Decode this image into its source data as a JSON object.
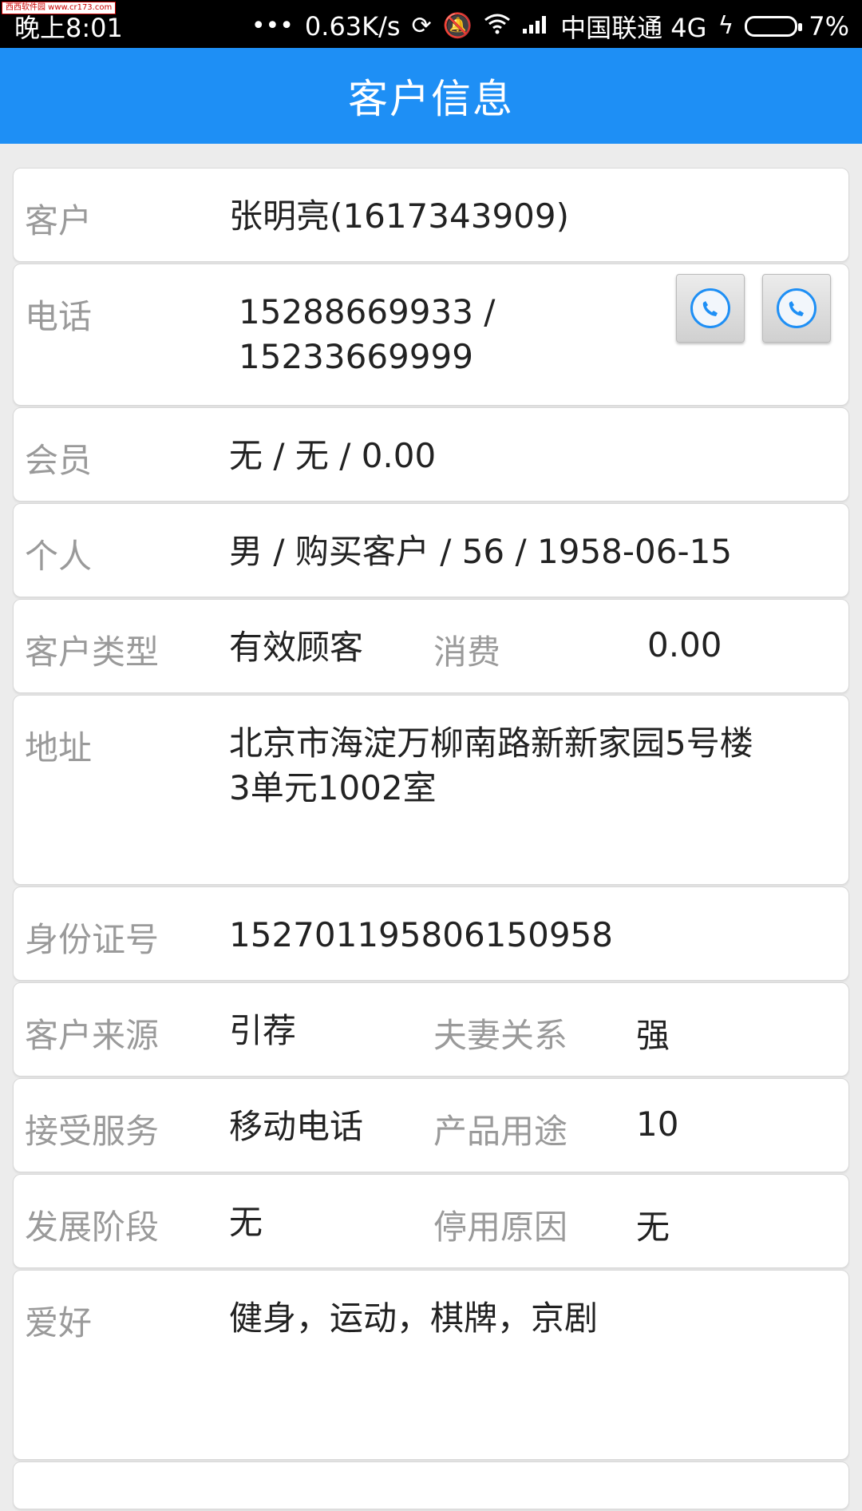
{
  "status_bar": {
    "time": "晚上8:01",
    "speed": "0.63K/s",
    "carrier": "中国联通 4G",
    "battery": "7%",
    "watermark": "西西软件园 www.cr173.com"
  },
  "header": {
    "title": "客户信息"
  },
  "rows": [
    {
      "label": "客户",
      "value": "张明亮(1617343909)"
    },
    {
      "label": "电话",
      "value": "15288669933 /",
      "value_line2": "15233669999"
    },
    {
      "label": "会员",
      "value": "无 / 无 / 0.00"
    },
    {
      "label": "个人",
      "value": "男 / 购买客户 / 56 / 1958-06-15"
    },
    {
      "label": "客户类型",
      "value": "有效顾客",
      "label2": "消费",
      "value2": "0.00"
    },
    {
      "label": "地址",
      "value": "北京市海淀万柳南路新新家园5号楼",
      "value_line2": "3单元1002室"
    },
    {
      "label": "身份证号",
      "value": "152701195806150958"
    },
    {
      "label": "客户来源",
      "value": "引荐",
      "label2": "夫妻关系",
      "value2": "强"
    },
    {
      "label": "接受服务",
      "value": "移动电话",
      "label2": "产品用途",
      "value2": "10"
    },
    {
      "label": "发展阶段",
      "value": "无",
      "label2": "停用原因",
      "value2": "无"
    },
    {
      "label": "爱好",
      "value": "健身，运动，棋牌，京剧"
    }
  ],
  "colors": {
    "primary": "#1e8ff5",
    "label": "#9a9a9a",
    "background": "#ececec"
  },
  "icons": {
    "call": "phone-icon"
  }
}
